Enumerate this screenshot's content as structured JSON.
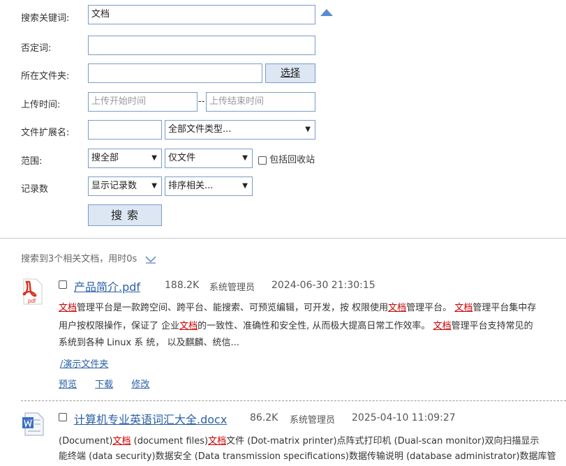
{
  "form": {
    "keyword_label": "搜索关键词:",
    "keyword_value": "文档",
    "negative_label": "否定词:",
    "negative_value": "",
    "folder_label": "所在文件夹:",
    "folder_value": "",
    "choose_button": "选择",
    "upload_time_label": "上传时间:",
    "upload_start_placeholder": "上传开始时间",
    "range_sep": "--",
    "upload_end_placeholder": "上传结束时间",
    "ext_label": "文件扩展名:",
    "ext_value": "",
    "filetype_select": "全部文件类型...",
    "scope_label": "范围:",
    "scope_select": "搜全部",
    "only_select": "仅文件",
    "recycle_label": "包括回收站",
    "records_label": "记录数",
    "records_select": "显示记录数",
    "sort_select": "排序相关...",
    "search_button": "搜 索",
    "collapse_icon": "triangle-up-icon"
  },
  "summary": "搜索到3个相关文档，用时0s",
  "results": [
    {
      "icon": "pdf-file-icon",
      "icon_label": "pdf",
      "name": "产品简介.pdf",
      "size": "188.2K",
      "owner": "系统管理员",
      "date": "2024-06-30 21:30:15",
      "line1": [
        {
          "t": "文档",
          "h": true
        },
        {
          "t": "管理平台是一款跨空间、跨平台、能搜索、可预览编辑，可开发，按 权限使用",
          "h": false
        },
        {
          "t": "文档",
          "h": true
        },
        {
          "t": "管理平台。 ",
          "h": false
        },
        {
          "t": "文档",
          "h": true
        },
        {
          "t": "管理平台集中存",
          "h": false
        }
      ],
      "line2": [
        {
          "t": "用户按权限操作，保证了 企业",
          "h": false
        },
        {
          "t": "文档",
          "h": true
        },
        {
          "t": "的一致性、准确性和安全性, 从而极大提高日常工作效率。 ",
          "h": false
        },
        {
          "t": "文档",
          "h": true
        },
        {
          "t": "管理平台支持常见的",
          "h": false
        }
      ],
      "line3": [
        {
          "t": "系统到各种 Linux 系 统， 以及麒麟、统信...",
          "h": false
        }
      ],
      "folder": "/演示文件夹",
      "actions": [
        "预览",
        "下载",
        "修改"
      ]
    },
    {
      "icon": "word-file-icon",
      "name": "计算机专业英语词汇大全.docx",
      "size": "86.2K",
      "owner": "系统管理员",
      "date": "2025-04-10 11:09:27",
      "line1": [
        {
          "t": "(Document)",
          "h": false
        },
        {
          "t": "文档",
          "h": true
        },
        {
          "t": " (document files)",
          "h": false
        },
        {
          "t": "文档",
          "h": true
        },
        {
          "t": "文件 (Dot-matrix printer)点阵式打印机 (Dual-scan monitor)双向扫描显示",
          "h": false
        }
      ],
      "line2": [
        {
          "t": "能终端 (data security)数据安全 (Data transmission specifications)数据传输说明 (database administrator)数据库管",
          "h": false
        }
      ]
    }
  ]
}
